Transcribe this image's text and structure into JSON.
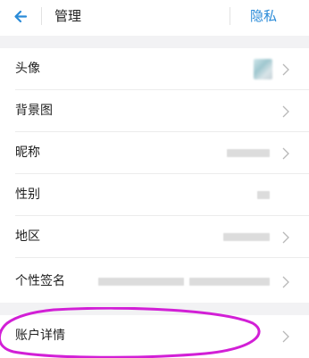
{
  "header": {
    "back_icon": "back-arrow-icon",
    "title": "管理",
    "privacy_label": "隐私",
    "accent_color": "#2a8bd8"
  },
  "rows": [
    {
      "label": "头像",
      "value_type": "avatar"
    },
    {
      "label": "背景图",
      "value_type": "none"
    },
    {
      "label": "昵称",
      "value_type": "hidden"
    },
    {
      "label": "性别",
      "value_type": "hidden"
    },
    {
      "label": "地区",
      "value_type": "hidden"
    },
    {
      "label": "个性签名",
      "value_type": "hidden"
    }
  ],
  "account_row": {
    "label": "账户详情"
  },
  "annotation_color": "#d21fd6",
  "chevron_icon": "chevron-right-icon"
}
